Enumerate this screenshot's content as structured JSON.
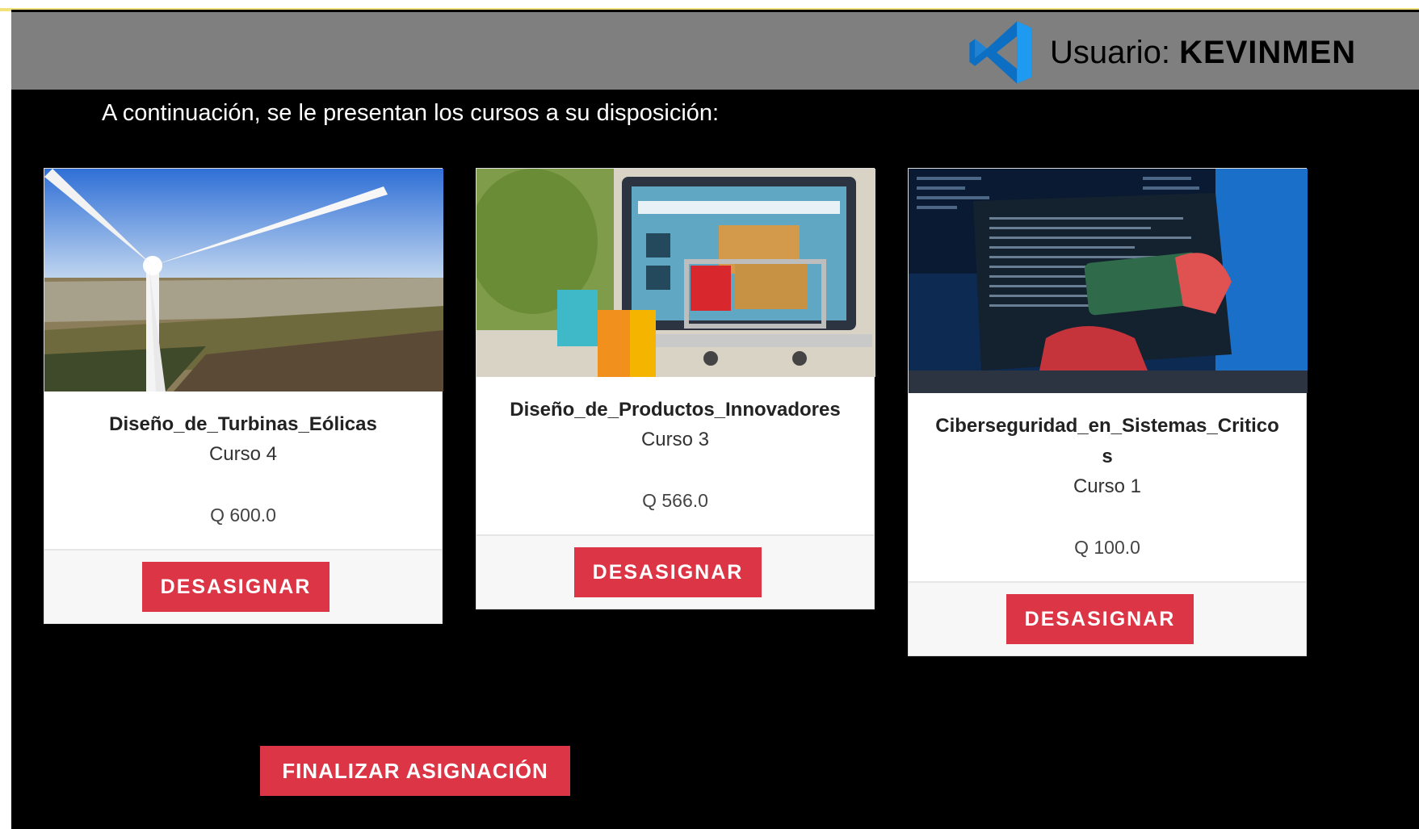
{
  "header": {
    "user_prefix": "Usuario: ",
    "user_name": "KEVINMEN",
    "logo_icon": "vscode-logo-icon",
    "accent": "#1e88e5"
  },
  "intro_text": "A continuación, se le presentan los cursos a su disposición:",
  "courses": [
    {
      "title": "Diseño_de_Turbinas_Eólicas",
      "subtitle": "Curso 4",
      "price": "Q 600.0",
      "button": "DESASIGNAR",
      "image_icon": "wind-turbine-image"
    },
    {
      "title": "Diseño_de_Productos_Innovadores",
      "subtitle": "Curso 3",
      "price": "Q 566.0",
      "button": "DESASIGNAR",
      "image_icon": "shopping-cart-laptop-image"
    },
    {
      "title": "Ciberseguridad_en_Sistemas_Criticos",
      "subtitle": "Curso 1",
      "price": "Q 100.0",
      "button": "DESASIGNAR",
      "image_icon": "laptop-code-image"
    }
  ],
  "finalize_button": "FINALIZAR ASIGNACIÓN",
  "colors": {
    "button": "#dc3545",
    "header": "#7f7f7f",
    "background": "#000000"
  }
}
